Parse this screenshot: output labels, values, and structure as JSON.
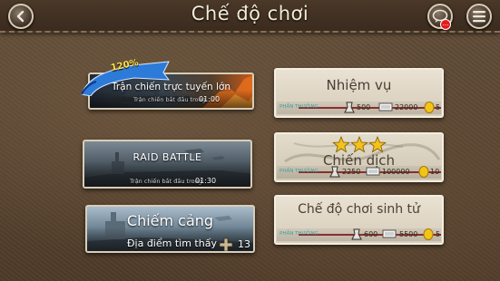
{
  "header": {
    "title": "Chế độ chơi",
    "notification_count": "..."
  },
  "modes_left": [
    {
      "title": "Trận chiến trực tuyến lớn",
      "subtitle": "Trận chiến bắt đầu trong",
      "time": "01:00",
      "bonus": "120%"
    },
    {
      "title": "RAID BATTLE",
      "subtitle": "Trận chiến bắt đầu trong",
      "time": "01:30"
    },
    {
      "title": "Chiếm cảng",
      "subtitle": "Địa điểm tìm thấy",
      "count": "13"
    }
  ],
  "modes_right": [
    {
      "title": "Nhiệm vụ",
      "reward_label": "PHẦN THƯỞNG",
      "exp": "500",
      "silver": "22000",
      "gold": "5"
    },
    {
      "title": "Chiến dịch",
      "stars": 3,
      "reward_label": "PHẦN THƯỞNG",
      "exp": "2250",
      "silver": "100000",
      "gold": "10"
    },
    {
      "title": "Chế độ chơi sinh tử",
      "reward_label": "PHẦN THƯỞNG",
      "exp": "600",
      "silver": "5500",
      "gold": "5"
    }
  ],
  "colors": {
    "star": "#f3c21b",
    "gold": "#f2c418",
    "notification": "#e51c1c",
    "reward_label": "#3aa0a0"
  }
}
